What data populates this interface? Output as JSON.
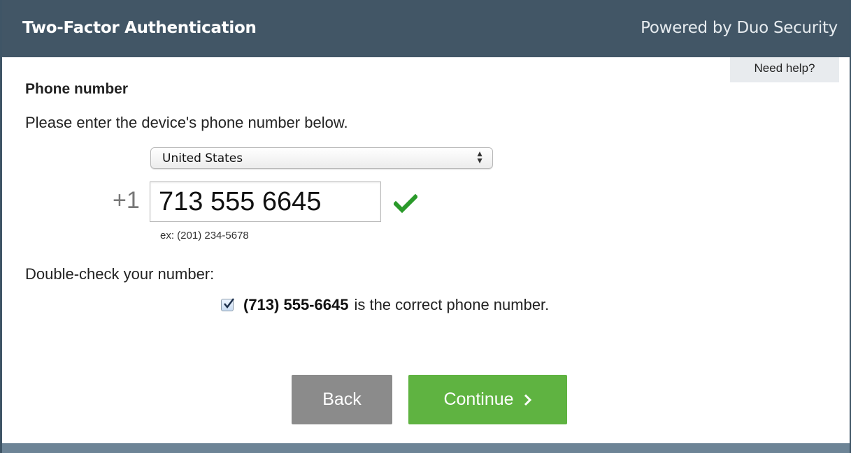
{
  "header": {
    "title": "Two-Factor Authentication",
    "powered_by": "Powered by Duo Security"
  },
  "help": {
    "label": "Need help?"
  },
  "form": {
    "section_title": "Phone number",
    "instruction": "Please enter the device's phone number below.",
    "country": {
      "selected": "United States"
    },
    "phone": {
      "prefix": "+1",
      "value": "713 555 6645",
      "example": "ex: (201) 234-5678",
      "valid": true
    },
    "double_check_label": "Double-check your number:",
    "confirm": {
      "checked": true,
      "number": "(713) 555-6645",
      "text": "is the correct phone number."
    }
  },
  "buttons": {
    "back": "Back",
    "continue": "Continue"
  },
  "colors": {
    "header_bg": "#425666",
    "continue_bg": "#5fb341",
    "back_bg": "#8b8b8b",
    "check_green": "#2a9a2a"
  }
}
